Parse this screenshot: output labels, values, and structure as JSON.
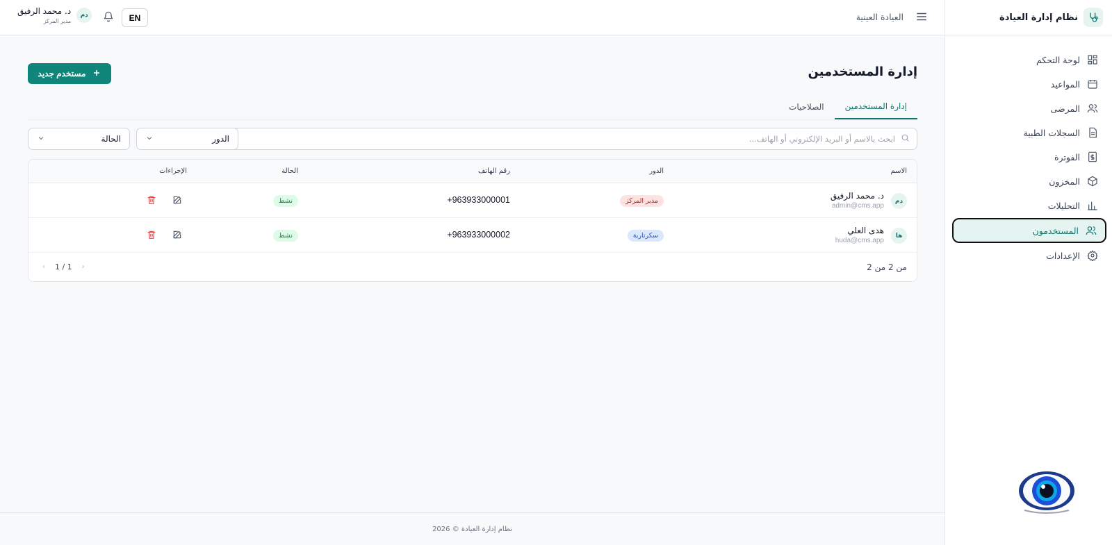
{
  "app": {
    "title": "نظام إدارة العيادة"
  },
  "sidebar": {
    "items": [
      {
        "label": "لوحة التحكم",
        "icon": "dashboard-icon"
      },
      {
        "label": "المواعيد",
        "icon": "calendar-icon"
      },
      {
        "label": "المرضى",
        "icon": "patients-icon"
      },
      {
        "label": "السجلات الطبية",
        "icon": "records-icon"
      },
      {
        "label": "الفوترة",
        "icon": "billing-icon"
      },
      {
        "label": "المخزون",
        "icon": "inventory-icon"
      },
      {
        "label": "التحليلات",
        "icon": "analytics-icon"
      },
      {
        "label": "المستخدمون",
        "icon": "users-icon",
        "active": true
      },
      {
        "label": "الإعدادات",
        "icon": "settings-icon"
      }
    ]
  },
  "header": {
    "clinic_name": "العيادة العينية",
    "lang_button": "EN",
    "user": {
      "initials": "دم",
      "name": "د. محمد الرفيق",
      "role": "مدير المركز"
    }
  },
  "page": {
    "title": "إدارة المستخدمين",
    "new_button": "مستخدم جديد",
    "tabs": [
      {
        "label": "إدارة المستخدمين",
        "active": true
      },
      {
        "label": "الصلاحيات",
        "active": false
      }
    ],
    "search": {
      "placeholder": "ابحث بالاسم أو البريد الإلكتروني أو الهاتف..."
    },
    "filters": {
      "role": "الدور",
      "status": "الحالة"
    }
  },
  "table": {
    "columns": {
      "name": "الاسم",
      "role": "الدور",
      "phone": "رقم الهاتف",
      "status": "الحالة",
      "actions": "الإجراءات"
    },
    "rows": [
      {
        "initials": "دم",
        "name": "د. محمد الرفيق",
        "email": "admin@cms.app",
        "role": "مدير المركز",
        "phone": "+963933000001",
        "status": "نشط"
      },
      {
        "initials": "ها",
        "name": "هدى العلي",
        "email": "huda@cms.app",
        "role": "سكرتارية",
        "phone": "+963933000002",
        "status": "نشط"
      }
    ],
    "count_text": "من 2 من 2",
    "pagination": "1 / 1"
  },
  "footer": {
    "text": "نظام إدارة العيادة © 2026"
  },
  "colors": {
    "primary": "#10867a",
    "accent_bg": "#e6f4f1",
    "danger": "#ef4444"
  }
}
